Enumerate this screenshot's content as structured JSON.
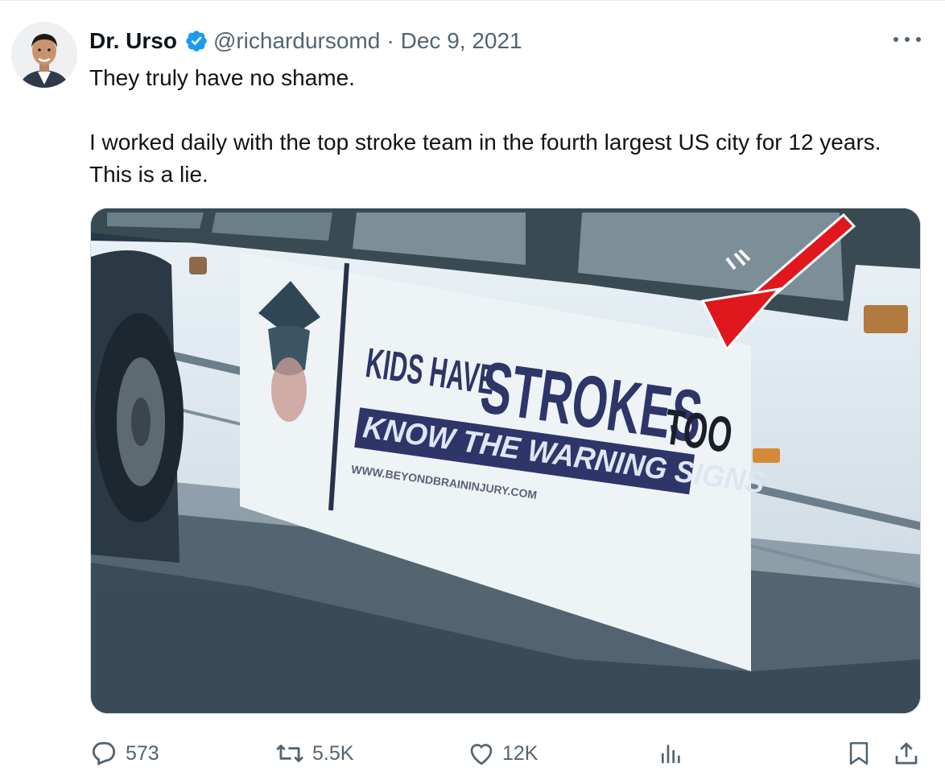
{
  "tweet": {
    "author": {
      "display_name": "Dr. Urso",
      "verified": true,
      "handle": "@richardursomd",
      "avatar_icon": "avatar-photo"
    },
    "separator": "·",
    "date": "Dec 9, 2021",
    "text": {
      "line1": "They truly have no shame.",
      "line2": "I worked daily with the top stroke team in the fourth largest US city for 12 years. This is a lie."
    },
    "media": {
      "sign_small": "KIDS HAVE",
      "sign_big": "STROKES",
      "sign_too": "TOO",
      "sign_banner": "KNOW THE WARNING SIGNS",
      "sign_url": "WWW.BEYONDBRAININJURY.COM"
    },
    "actions": {
      "replies": "573",
      "reposts": "5.5K",
      "likes": "12K"
    }
  },
  "colors": {
    "verified_blue": "#1d9bf0",
    "secondary_text": "#536471",
    "primary_text": "#0f1419",
    "arrow_red": "#e0171c",
    "sign_navy": "#2d3569"
  }
}
